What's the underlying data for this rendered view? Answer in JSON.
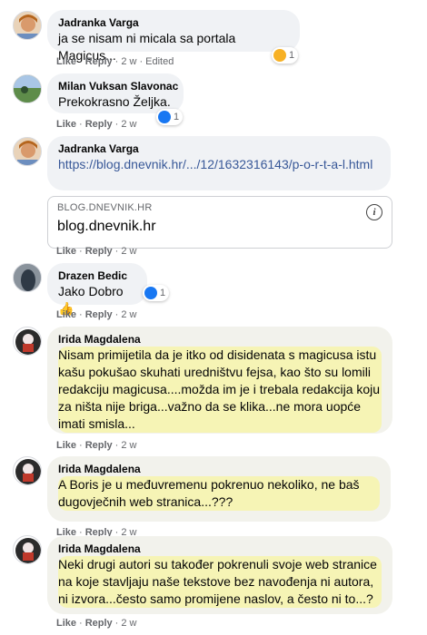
{
  "comments": [
    {
      "author": "Jadranka Varga",
      "text": "ja se nisam ni micala sa portala Magicus...",
      "actions": {
        "like": "Like",
        "reply": "Reply",
        "time": "2 w",
        "edited": "Edited"
      },
      "reaction": {
        "icon": "haha-icon",
        "count": "1"
      }
    },
    {
      "author": "Milan Vuksan Slavonac",
      "text": "Prekokrasno Željka.",
      "actions": {
        "like": "Like",
        "reply": "Reply",
        "time": "2 w"
      },
      "reaction": {
        "icon": "like-icon",
        "count": "1"
      }
    },
    {
      "author": "Jadranka Varga",
      "link": "https://blog.dnevnik.hr/.../12/1632316143/p-o-r-t-a-l.html",
      "preview": {
        "domain": "BLOG.DNEVNIK.HR",
        "title": "blog.dnevnik.hr"
      },
      "actions": {
        "like": "Like",
        "reply": "Reply",
        "time": "2 w"
      }
    },
    {
      "author": "Drazen Bedic",
      "text": "Jako Dobro",
      "actions": {
        "like": "Like",
        "reply": "Reply",
        "time": "2 w"
      },
      "reaction": {
        "icon": "like-icon",
        "count": "1"
      }
    },
    {
      "author": "Irida Magdalena",
      "text": "Nisam primijetila da je itko od disidenata s magicusa istu kašu pokušao skuhati uredništvu fejsa, kao što su lomili redakciju magicusa....možda im je i trebala redakcija koju za ništa nije briga...važno da se klika...ne mora uopće imati smisla...",
      "actions": {
        "like": "Like",
        "reply": "Reply",
        "time": "2 w"
      }
    },
    {
      "author": "Irida Magdalena",
      "text": "A Boris je u međuvremenu pokrenuo nekoliko, ne baš dugovječnih web stranica...???",
      "actions": {
        "like": "Like",
        "reply": "Reply",
        "time": "2 w"
      }
    },
    {
      "author": "Irida Magdalena",
      "text": "Neki drugi autori su također pokrenuli svoje web stranice na koje stavljaju naše tekstove bez navođenja ni autora, ni izvora...često samo promijene naslov, a često ni to...?",
      "actions": {
        "like": "Like",
        "reply": "Reply",
        "time": "2 w"
      }
    }
  ],
  "colors": {
    "highlight": "#f6f4b5",
    "bubble": "#f0f2f5",
    "link": "#385898",
    "like": "#1877f2"
  }
}
